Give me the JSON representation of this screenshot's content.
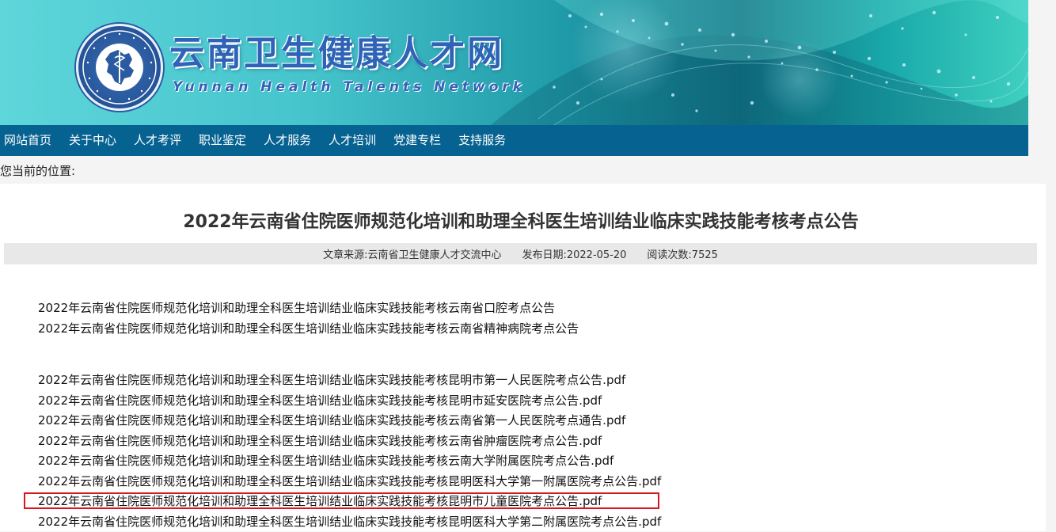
{
  "header": {
    "title": "云南卫生健康人才网",
    "subtitle": "Yunnan Health Talents Network"
  },
  "nav": {
    "items": [
      "网站首页",
      "关于中心",
      "人才考评",
      "职业鉴定",
      "人才服务",
      "人才培训",
      "党建专栏",
      "支持服务"
    ]
  },
  "location": {
    "label": "您当前的位置:"
  },
  "article": {
    "title": "2022年云南省住院医师规范化培训和助理全科医生培训结业临床实践技能考核考点公告",
    "source": "文章来源:云南省卫生健康人才交流中心",
    "date": "发布日期:2022-05-20",
    "views": "阅读次数:7525",
    "links": [
      "2022年云南省住院医师规范化培训和助理全科医生培训结业临床实践技能考核云南省口腔考点公告",
      "2022年云南省住院医师规范化培训和助理全科医生培训结业临床实践技能考核云南省精神病院考点公告"
    ],
    "pdf_links": [
      "2022年云南省住院医师规范化培训和助理全科医生培训结业临床实践技能考核昆明市第一人民医院考点公告.pdf",
      "2022年云南省住院医师规范化培训和助理全科医生培训结业临床实践技能考核昆明市延安医院考点公告.pdf",
      "2022年云南省住院医师规范化培训和助理全科医生培训结业临床实践技能考核云南省第一人民医院考点通告.pdf",
      "2022年云南省住院医师规范化培训和助理全科医生培训结业临床实践技能考核云南省肿瘤医院考点公告.pdf",
      "2022年云南省住院医师规范化培训和助理全科医生培训结业临床实践技能考核云南大学附属医院考点公告.pdf",
      "2022年云南省住院医师规范化培训和助理全科医生培训结业临床实践技能考核昆明医科大学第一附属医院考点公告.pdf",
      "2022年云南省住院医师规范化培训和助理全科医生培训结业临床实践技能考核昆明市儿童医院考点公告.pdf",
      "2022年云南省住院医师规范化培训和助理全科医生培训结业临床实践技能考核昆明医科大学第二附属医院考点公告.pdf"
    ]
  },
  "icons": {
    "logo": "yunnan-map-seal-icon"
  }
}
